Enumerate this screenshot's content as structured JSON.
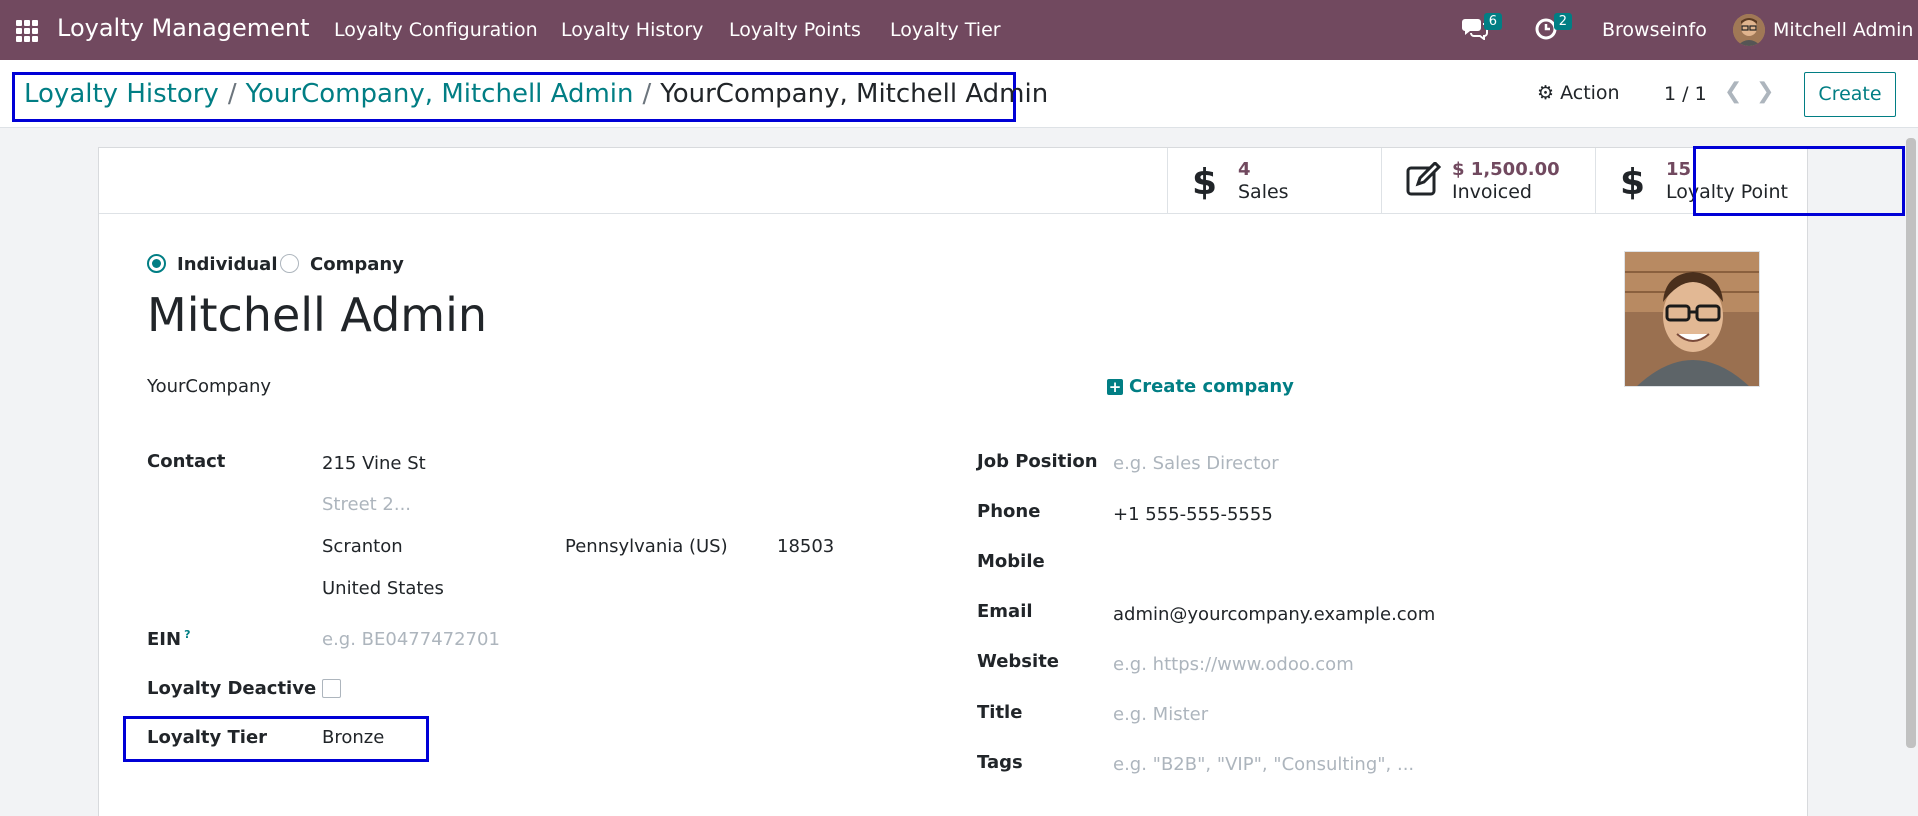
{
  "navbar": {
    "brand": "Loyalty Management",
    "menus": [
      "Loyalty Configuration",
      "Loyalty History",
      "Loyalty Points",
      "Loyalty Tier"
    ],
    "messages_count": "6",
    "activities_count": "2",
    "company": "Browseinfo",
    "user": "Mitchell Admin"
  },
  "control": {
    "breadcrumbs": [
      "Loyalty History",
      "YourCompany, Mitchell Admin",
      "YourCompany, Mitchell Admin"
    ],
    "action_label": "Action",
    "pager": "1 / 1",
    "create_label": "Create"
  },
  "smart_buttons": {
    "sales": {
      "value": "4",
      "label": "Sales"
    },
    "invoiced": {
      "value": "$ 1,500.00",
      "label": "Invoiced"
    },
    "loyalty": {
      "value": "15",
      "label": "Loyalty Point"
    }
  },
  "form": {
    "type_options": [
      "Individual",
      "Company"
    ],
    "type_selected": "Individual",
    "name": "Mitchell Admin",
    "company": "YourCompany",
    "create_company_label": "Create company",
    "contact": {
      "label": "Contact",
      "street": "215 Vine St",
      "street2_placeholder": "Street 2...",
      "city": "Scranton",
      "state": "Pennsylvania (US)",
      "zip": "18503",
      "country": "United States"
    },
    "ein": {
      "label": "EIN",
      "tooltip": "?",
      "placeholder": "e.g. BE0477472701"
    },
    "loyalty_deactive": {
      "label": "Loyalty Deactive",
      "checked": false
    },
    "loyalty_tier": {
      "label": "Loyalty Tier",
      "value": "Bronze"
    },
    "job_position": {
      "label": "Job Position",
      "placeholder": "e.g. Sales Director"
    },
    "phone": {
      "label": "Phone",
      "value": "+1 555-555-5555"
    },
    "mobile": {
      "label": "Mobile",
      "value": ""
    },
    "email": {
      "label": "Email",
      "value": "admin@yourcompany.example.com"
    },
    "website": {
      "label": "Website",
      "placeholder": "e.g. https://www.odoo.com"
    },
    "title": {
      "label": "Title",
      "placeholder": "e.g. Mister"
    },
    "tags": {
      "label": "Tags",
      "placeholder": "e.g. \"B2B\", \"VIP\", \"Consulting\", ..."
    }
  },
  "colors": {
    "navbar": "#71495f",
    "accent": "#017e84",
    "highlight_box": "#0000d6"
  }
}
